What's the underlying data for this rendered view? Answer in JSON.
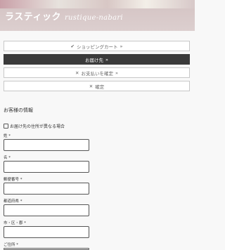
{
  "header": {
    "brand_jp": "ラスティック",
    "brand_en": "rustique-nabari"
  },
  "steps": [
    {
      "icon": "✔",
      "label": "ショッピングカート",
      "arrow": "»",
      "state": "done"
    },
    {
      "icon": "",
      "label": "お届け先",
      "arrow": "»",
      "state": "active"
    },
    {
      "icon": "✕",
      "label": "お支払いを確定",
      "arrow": "»",
      "state": "pending"
    },
    {
      "icon": "✕",
      "label": "確定",
      "arrow": "",
      "state": "pending"
    }
  ],
  "form": {
    "section_title": "お客様の情報",
    "alt_address_label": "お届け先の住所が異なる場合",
    "fields": [
      {
        "label": "姓 *",
        "value": ""
      },
      {
        "label": "名 *",
        "value": ""
      },
      {
        "label": "郵便番号 *",
        "value": ""
      },
      {
        "label": "都道府県 *",
        "value": ""
      },
      {
        "label": "市・区・郡 *",
        "value": ""
      },
      {
        "label": "ご住所 *",
        "value": ""
      }
    ]
  },
  "colors": {
    "active_step_bg": "#3a3a3a",
    "header_bg": "#d9cccc"
  }
}
